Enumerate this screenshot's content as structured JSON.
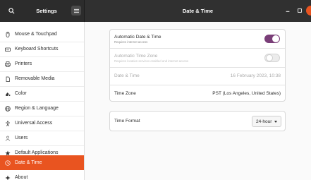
{
  "header": {
    "app_title": "Settings",
    "page_title": "Date & Time"
  },
  "sidebar": {
    "items": [
      {
        "label": "Mouse & Touchpad",
        "icon": "mouse-icon"
      },
      {
        "label": "Keyboard Shortcuts",
        "icon": "keyboard-icon"
      },
      {
        "label": "Printers",
        "icon": "printer-icon"
      },
      {
        "label": "Removable Media",
        "icon": "removable-media-icon"
      },
      {
        "label": "Color",
        "icon": "color-icon"
      },
      {
        "label": "Region & Language",
        "icon": "globe-icon"
      },
      {
        "label": "Universal Access",
        "icon": "accessibility-icon"
      },
      {
        "label": "Users",
        "icon": "users-icon"
      },
      {
        "label": "Default Applications",
        "icon": "star-icon"
      },
      {
        "label": "Date & Time",
        "icon": "clock-icon",
        "active": true
      },
      {
        "label": "About",
        "icon": "about-icon"
      }
    ]
  },
  "datetime": {
    "auto_datetime": {
      "title": "Automatic Date & Time",
      "subtitle": "Requires internet access",
      "enabled": true
    },
    "auto_timezone": {
      "title": "Automatic Time Zone",
      "subtitle": "Requires location services enabled and internet access",
      "enabled": false
    },
    "date_time": {
      "label": "Date & Time",
      "value": "16 February 2023, 10:38"
    },
    "time_zone": {
      "label": "Time Zone",
      "value": "PST (Los Angeles, United States)"
    }
  },
  "time_format": {
    "label": "Time Format",
    "value": "24-hour"
  },
  "colors": {
    "accent": "#e95420",
    "switch_on": "#7a3e78",
    "header": "#303030"
  }
}
